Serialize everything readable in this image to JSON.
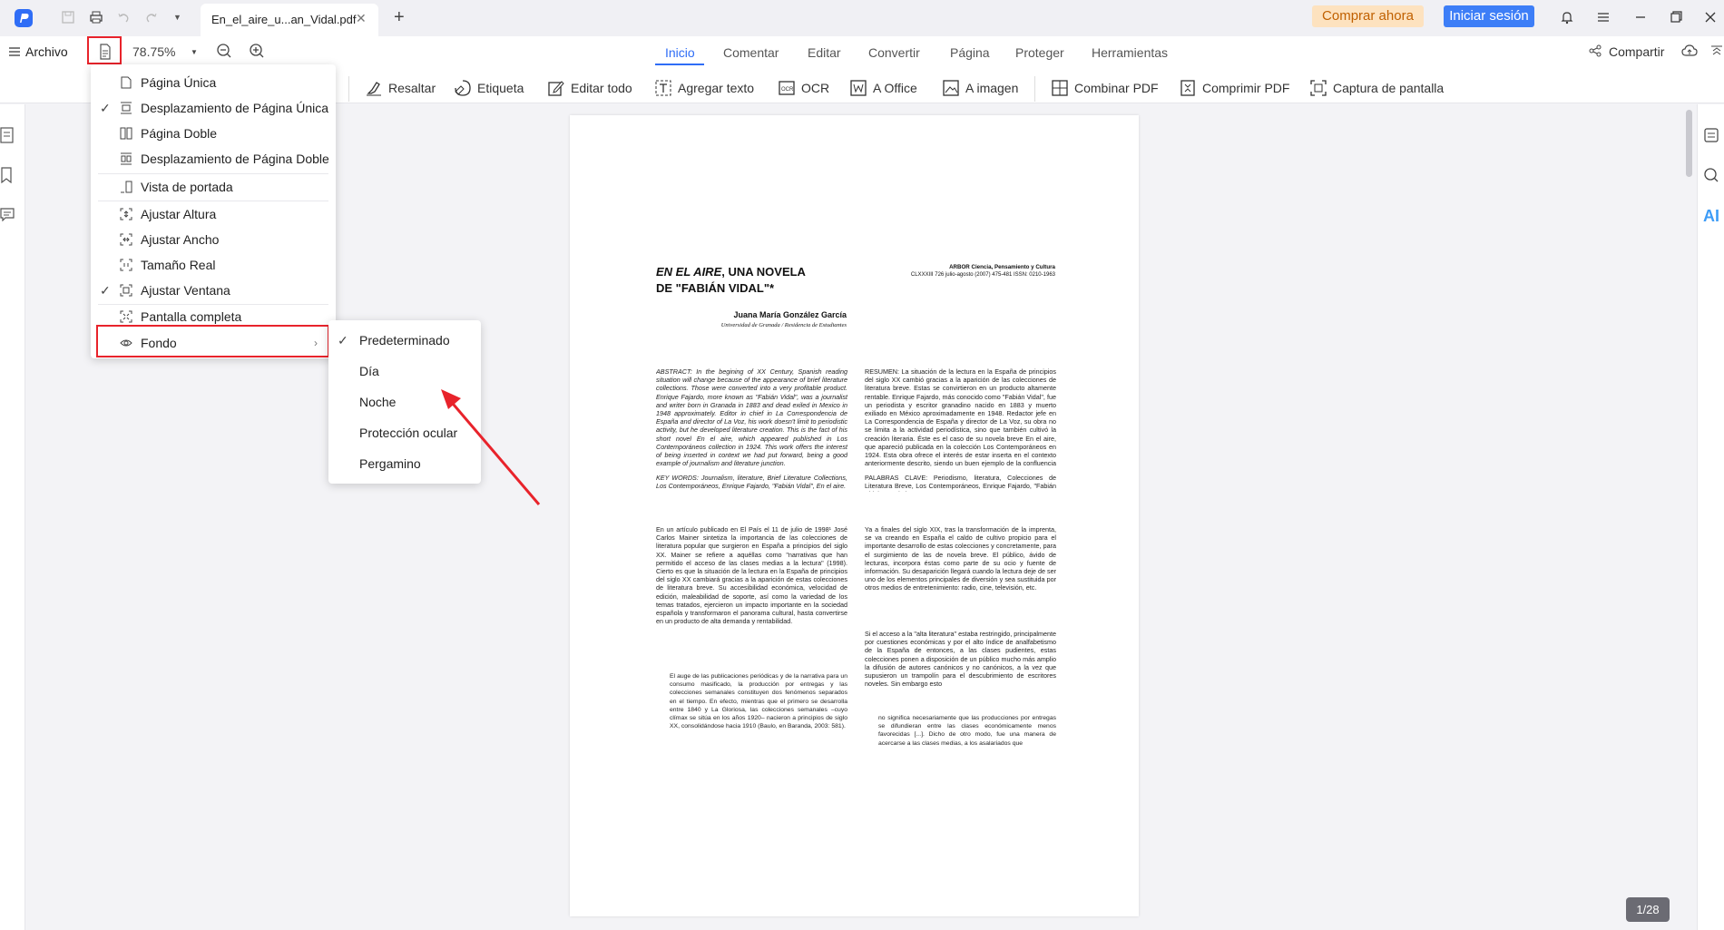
{
  "titlebar": {
    "tab_title": "En_el_aire_u...an_Vidal.pdf",
    "buy_label": "Comprar ahora",
    "login_label": "Iniciar sesión"
  },
  "toolbar": {
    "file_label": "Archivo",
    "zoom": "78.75%",
    "nav_tabs": [
      "Inicio",
      "Comentar",
      "Editar",
      "Convertir",
      "Página",
      "Proteger",
      "Herramientas"
    ],
    "active_tab": "Inicio",
    "share_label": "Compartir",
    "tools": [
      "Resaltar",
      "Etiqueta",
      "Editar todo",
      "Agregar texto",
      "OCR",
      "A Office",
      "A imagen",
      "Combinar PDF",
      "Comprimir PDF",
      "Captura de pantalla"
    ]
  },
  "view_menu": {
    "items": [
      {
        "label": "Página Única",
        "checked": false
      },
      {
        "label": "Desplazamiento de Página Única",
        "checked": true
      },
      {
        "label": "Página Doble",
        "checked": false
      },
      {
        "label": "Desplazamiento de Página Doble",
        "checked": false
      },
      {
        "label": "Vista de portada",
        "checked": false
      },
      {
        "label": "Ajustar Altura",
        "checked": false
      },
      {
        "label": "Ajustar Ancho",
        "checked": false
      },
      {
        "label": "Tamaño Real",
        "checked": false
      },
      {
        "label": "Ajustar Ventana",
        "checked": true
      },
      {
        "label": "Pantalla completa",
        "checked": false
      },
      {
        "label": "Fondo",
        "checked": false
      }
    ]
  },
  "background_submenu": {
    "items": [
      {
        "label": "Predeterminado",
        "checked": true
      },
      {
        "label": "Día",
        "checked": false
      },
      {
        "label": "Noche",
        "checked": false
      },
      {
        "label": "Protección ocular",
        "checked": false
      },
      {
        "label": "Pergamino",
        "checked": false
      }
    ]
  },
  "document": {
    "title_line1_italic": "EN EL AIRE",
    "title_line1_rest": ", UNA NOVELA",
    "title_line2": "DE \"FABIÁN VIDAL\"*",
    "journal_line1": "ARBOR Ciencia, Pensamiento y Cultura",
    "journal_line2": "CLXXXIII 726 julio-agosto (2007) 475-481 ISSN: 0210-1963",
    "author": "Juana María González García",
    "affiliation": "Universidad de Granada / Residencia de Estudiantes",
    "abstract": "ABSTRACT: In the begining of XX Century, Spanish reading situation will change because of the appearance of brief literature collections. Those were converted into a very profitable product. Enrique Fajardo, more known as \"Fabián Vidal\", was a journalist and writer born in Granada in 1883 and dead exiled in Mexico in 1948 approximately. Editor in chief in La Correspondencia de España and director of La Voz, his work doesn't limit to periodistic activity, but he developed literature creation. This is the fact of his short novel En el aire, which appeared published in Los Contemporáneos collection in 1924. This work offers the interest of being inserted in context we had put forward, being a good example of journalism and literature junction.",
    "keywords": "KEY WORDS: Journalism, literature, Brief Literature Collections, Los Contemporáneos, Enrique Fajardo, \"Fabián Vidal\", En el aire.",
    "resumen": "RESUMEN: La situación de la lectura en la España de principios del siglo XX cambió gracias a la aparición de las colecciones de literatura breve. Estas se convirtieron en un producto altamente rentable. Enrique Fajardo, más conocido como \"Fabián Vidal\", fue un periodista y escritor granadino nacido en 1883 y muerto exiliado en México aproximadamente en 1948. Redactor jefe en La Correspondencia de España y director de La Voz, su obra no se limita a la actividad periodística, sino que también cultivó la creación literaria. Éste es el caso de su novela breve En el aire, que apareció publicada en la colección Los Contemporáneos en 1924. Esta obra ofrece el interés de estar inserta en el contexto anteriormente descrito, siendo un buen ejemplo de la confluencia del periodismo y la literatura.",
    "palabras": "PALABRAS CLAVE: Periodismo, literatura, Colecciones de Literatura Breve, Los Contemporáneos, Enrique Fajardo, \"Fabián Vidal\", En el aire.",
    "body_left": "En un artículo publicado en El País el 11 de julio de 1998¹ José Carlos Mainer sintetiza la importancia de las colecciones de literatura popular que surgieron en España a principios del siglo XX. Mainer se refiere a aquéllas como \"narrativas que han permitido el acceso de las clases medias a la lectura\" (1998). Cierto es que la situación de la lectura en la España de principios del siglo XX cambiará gracias a la aparición de estas colecciones de literatura breve. Su accesibilidad económica, velocidad de edición, maleabilidad de soporte, así como la variedad de los temas tratados, ejercieron un impacto importante en la sociedad española y transformaron el panorama cultural, hasta convertirse en un producto de alta demanda y rentabilidad.",
    "quote_left": "El auge de las publicaciones periódicas y de la narrativa para un consumo masificado, la producción por entregas y las colecciones semanales constituyen dos fenómenos separados en el tiempo. En efecto, mientras que el primero se desarrolla entre 1840 y La Gloriosa, las colecciones semanales –cuyo clímax se sitúa en los años 1920– nacieron a principios de siglo XX, consolidándose hacia 1910 (Baulo, en Baranda, 2003: 581).",
    "body_right": "Ya a finales del siglo XIX, tras la transformación de la imprenta, se va creando en España el caldo de cultivo propicio para el importante desarrollo de estas colecciones y concretamente, para el surgimiento de las de novela breve. El público, ávido de lecturas, incorpora éstas como parte de su ocio y fuente de información. Su desaparición llegará cuando la lectura deje de ser uno de los elementos principales de diversión y sea sustituida por otros medios de entretenimiento: radio, cine, televisión, etc.",
    "body_right2": "Si el acceso a la \"alta literatura\" estaba restringido, principalmente por cuestiones económicas y por el alto índice de analfabetismo de la España de entonces, a las clases pudientes, estas colecciones ponen a disposición de un público mucho más amplio la difusión de autores canónicos y no canónicos, a la vez que supusieron un trampolín para el descubrimiento de escritores noveles. Sin embargo esto",
    "quote_right": "no significa necesariamente que las producciones por entregas se difundieran entre las clases económicamente menos favorecidas [...]. Dicho de otro modo, fue una manera de acercarse a las clases medias, a los asalariados que"
  },
  "page_indicator": "1/28",
  "colors": {
    "accent": "#3d7ef7",
    "highlight_red": "#e8232b",
    "buy_bg": "#fde2bf"
  }
}
